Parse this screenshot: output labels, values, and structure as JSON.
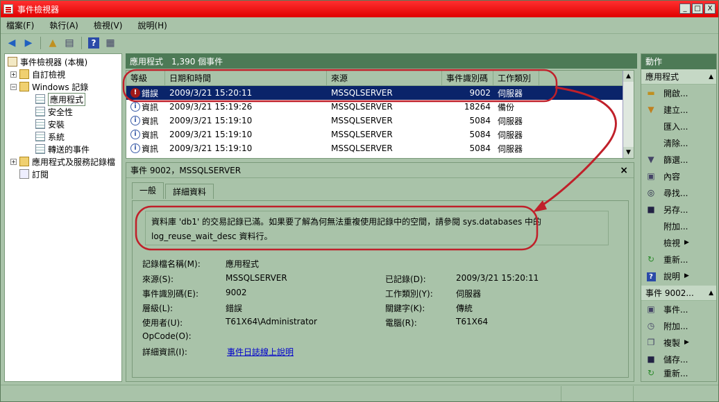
{
  "title": "事件檢視器",
  "window_buttons": [
    "_",
    "□",
    "X"
  ],
  "menu": [
    "檔案(F)",
    "執行(A)",
    "檢視(V)",
    "說明(H)"
  ],
  "tree": [
    {
      "label": "事件檢視器 (本機)",
      "level": 0,
      "icon": "event-viewer-icon"
    },
    {
      "label": "自訂檢視",
      "level": 1,
      "icon": "folder-icon",
      "expander": "+"
    },
    {
      "label": "Windows 記錄",
      "level": 1,
      "icon": "folder-icon",
      "expander": "-"
    },
    {
      "label": "應用程式",
      "level": 2,
      "icon": "log-icon",
      "selected": true
    },
    {
      "label": "安全性",
      "level": 2,
      "icon": "log-icon"
    },
    {
      "label": "安裝",
      "level": 2,
      "icon": "log-icon"
    },
    {
      "label": "系統",
      "level": 2,
      "icon": "log-icon"
    },
    {
      "label": "轉送的事件",
      "level": 2,
      "icon": "log-icon"
    },
    {
      "label": "應用程式及服務記錄檔",
      "level": 1,
      "icon": "folder-icon",
      "expander": "+"
    },
    {
      "label": "訂閱",
      "level": 1,
      "icon": "subscription-icon"
    }
  ],
  "center": {
    "log_name": "應用程式",
    "event_count": "1,390 個事件"
  },
  "columns": [
    "等級",
    "日期和時間",
    "來源",
    "事件識別碼",
    "工作類別"
  ],
  "rows": [
    {
      "level": "錯誤",
      "datetime": "2009/3/21 15:20:11",
      "source": "MSSQLSERVER",
      "id": "9002",
      "category": "伺服器",
      "type": "error"
    },
    {
      "level": "資訊",
      "datetime": "2009/3/21 15:19:26",
      "source": "MSSQLSERVER",
      "id": "18264",
      "category": "備份",
      "type": "info"
    },
    {
      "level": "資訊",
      "datetime": "2009/3/21 15:19:10",
      "source": "MSSQLSERVER",
      "id": "5084",
      "category": "伺服器",
      "type": "info"
    },
    {
      "level": "資訊",
      "datetime": "2009/3/21 15:19:10",
      "source": "MSSQLSERVER",
      "id": "5084",
      "category": "伺服器",
      "type": "info"
    },
    {
      "level": "資訊",
      "datetime": "2009/3/21 15:19:10",
      "source": "MSSQLSERVER",
      "id": "5084",
      "category": "伺服器",
      "type": "info"
    }
  ],
  "detail": {
    "header": "事件 9002，MSSQLSERVER",
    "close": "×",
    "tabs": [
      "一般",
      "詳細資料"
    ],
    "message_line1": "資料庫 'db1' 的交易記錄已滿。如果要了解為何無法重複使用記錄中的空間，請參閱 sys.databases 中的",
    "message_line2": "log_reuse_wait_desc 資料行。",
    "fields": {
      "log_name_label": "記錄檔名稱(M):",
      "log_name": "應用程式",
      "source_label": "來源(S):",
      "source": "MSSQLSERVER",
      "logged_label": "已記錄(D):",
      "logged": "2009/3/21 15:20:11",
      "event_id_label": "事件識別碼(E):",
      "event_id": "9002",
      "task_label": "工作類別(Y):",
      "task": "伺服器",
      "level_label": "層級(L):",
      "level": "錯誤",
      "keywords_label": "關鍵字(K):",
      "keywords": "傳統",
      "user_label": "使用者(U):",
      "user": "T61X64\\Administrator",
      "computer_label": "電腦(R):",
      "computer": "T61X64",
      "opcode_label": "OpCode(O):",
      "more_info_label": "詳細資訊(I):",
      "more_info_link": "事件日誌線上說明"
    }
  },
  "actions": {
    "header": "動作",
    "section1": "應用程式",
    "items1": [
      {
        "label": "開啟...",
        "icon": "open-folder-icon"
      },
      {
        "label": "建立...",
        "icon": "filter-create-icon"
      },
      {
        "label": "匯入...",
        "icon": "import-icon"
      },
      {
        "label": "清除...",
        "icon": "clear-icon"
      },
      {
        "label": "篩選...",
        "icon": "filter-icon"
      },
      {
        "label": "內容",
        "icon": "properties-icon"
      },
      {
        "label": "尋找...",
        "icon": "find-icon"
      },
      {
        "label": "另存...",
        "icon": "save-icon"
      },
      {
        "label": "附加...",
        "icon": "attach-icon"
      },
      {
        "label": "檢視",
        "icon": "view-icon",
        "submenu": true
      },
      {
        "label": "重新...",
        "icon": "refresh-icon"
      },
      {
        "label": "說明",
        "icon": "help-icon",
        "submenu": true
      }
    ],
    "section2": "事件 9002...",
    "items2": [
      {
        "label": "事件...",
        "icon": "event-properties-icon"
      },
      {
        "label": "附加...",
        "icon": "attach-task-icon"
      },
      {
        "label": "複製",
        "icon": "copy-icon",
        "submenu": true
      },
      {
        "label": "儲存...",
        "icon": "save-icon"
      },
      {
        "label": "重新...",
        "icon": "refresh-icon"
      }
    ]
  },
  "annotation_color": "#c0202a"
}
